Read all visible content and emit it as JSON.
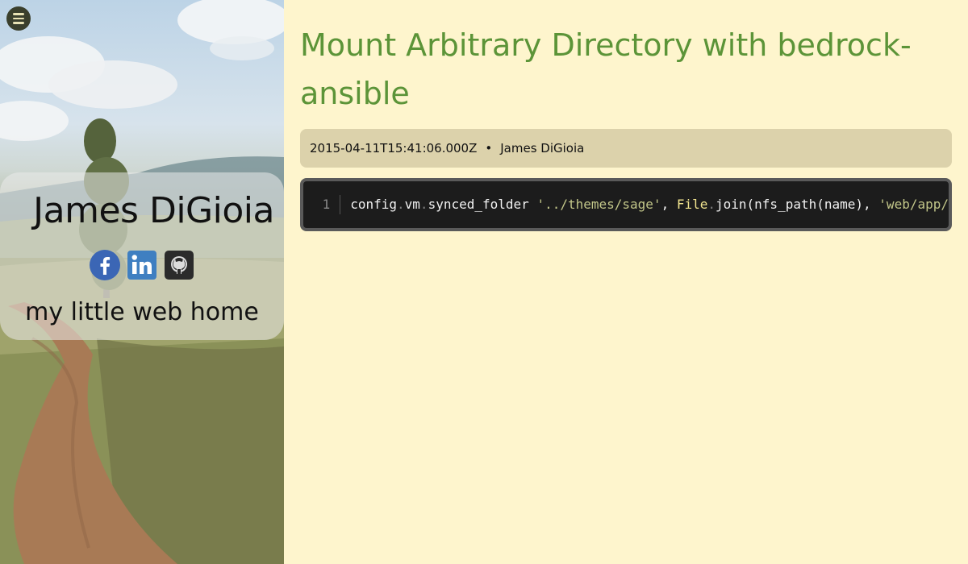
{
  "sidebar": {
    "name": "James DiGioia",
    "tagline": "my little web home",
    "social": [
      "facebook-icon",
      "linkedin-icon",
      "github-icon"
    ]
  },
  "post": {
    "title": "Mount Arbitrary Directory with bedrock-ansible",
    "date": "2015-04-11T15:41:06.000Z",
    "separator": "•",
    "author": "James DiGioia"
  },
  "code": {
    "line_number": "1",
    "tokens": {
      "t1": "config",
      "t2": ".",
      "t3": "vm",
      "t4": ".",
      "t5": "synced_folder",
      "t6": " ",
      "t7": "'../themes/sage'",
      "t8": ", ",
      "t9": "File",
      "t10": ".",
      "t11": "join",
      "t12": "(nfs_path(name), ",
      "t13": "'web/app/"
    }
  },
  "colors": {
    "background": "#fef5cd",
    "title": "#5c9438",
    "meta_bar": "#dcd2ab",
    "code_bg": "#1c1c1c",
    "string": "#c2c689",
    "constant": "#f2e58f"
  }
}
